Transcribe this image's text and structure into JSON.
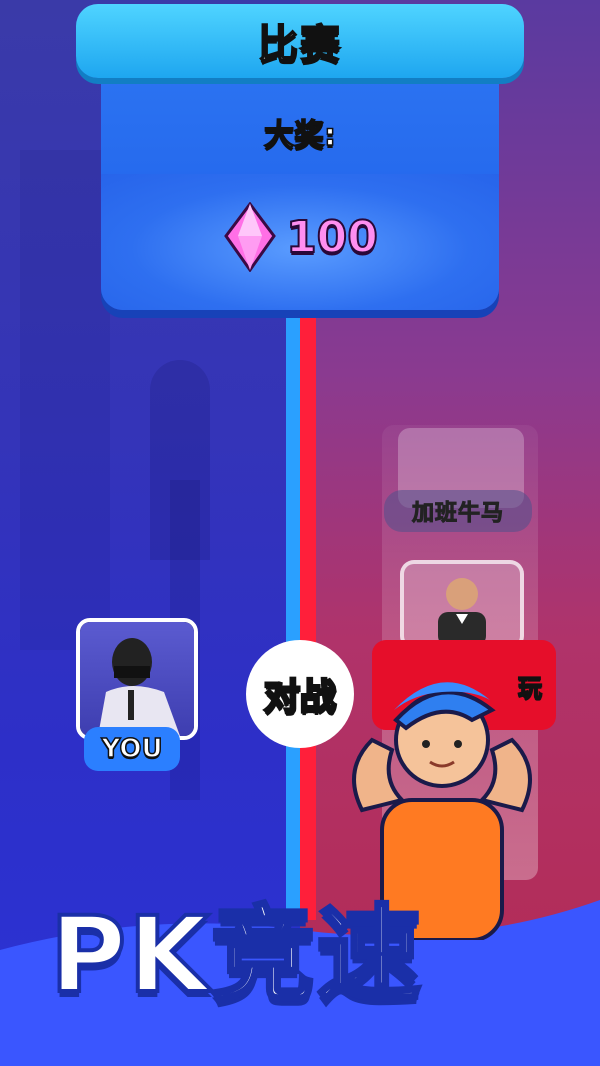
{
  "header": {
    "title": "比赛",
    "award_label": "大奖:",
    "prize_value": "100",
    "prize_icon": "pink-gem-icon"
  },
  "players": {
    "you_badge": "YOU",
    "opponent_name": "加班牛马",
    "opponent_card_text": "玩"
  },
  "vs_label": "对战",
  "banner": {
    "title": "PK竞速"
  },
  "colors": {
    "title_bar": "#1ea6f0",
    "panel": "#1f5fe8",
    "gem": "#ff8ef0",
    "left_team": "#2aa0ff",
    "right_team": "#ff1f3a",
    "banner_bg": "#3a56ff"
  }
}
